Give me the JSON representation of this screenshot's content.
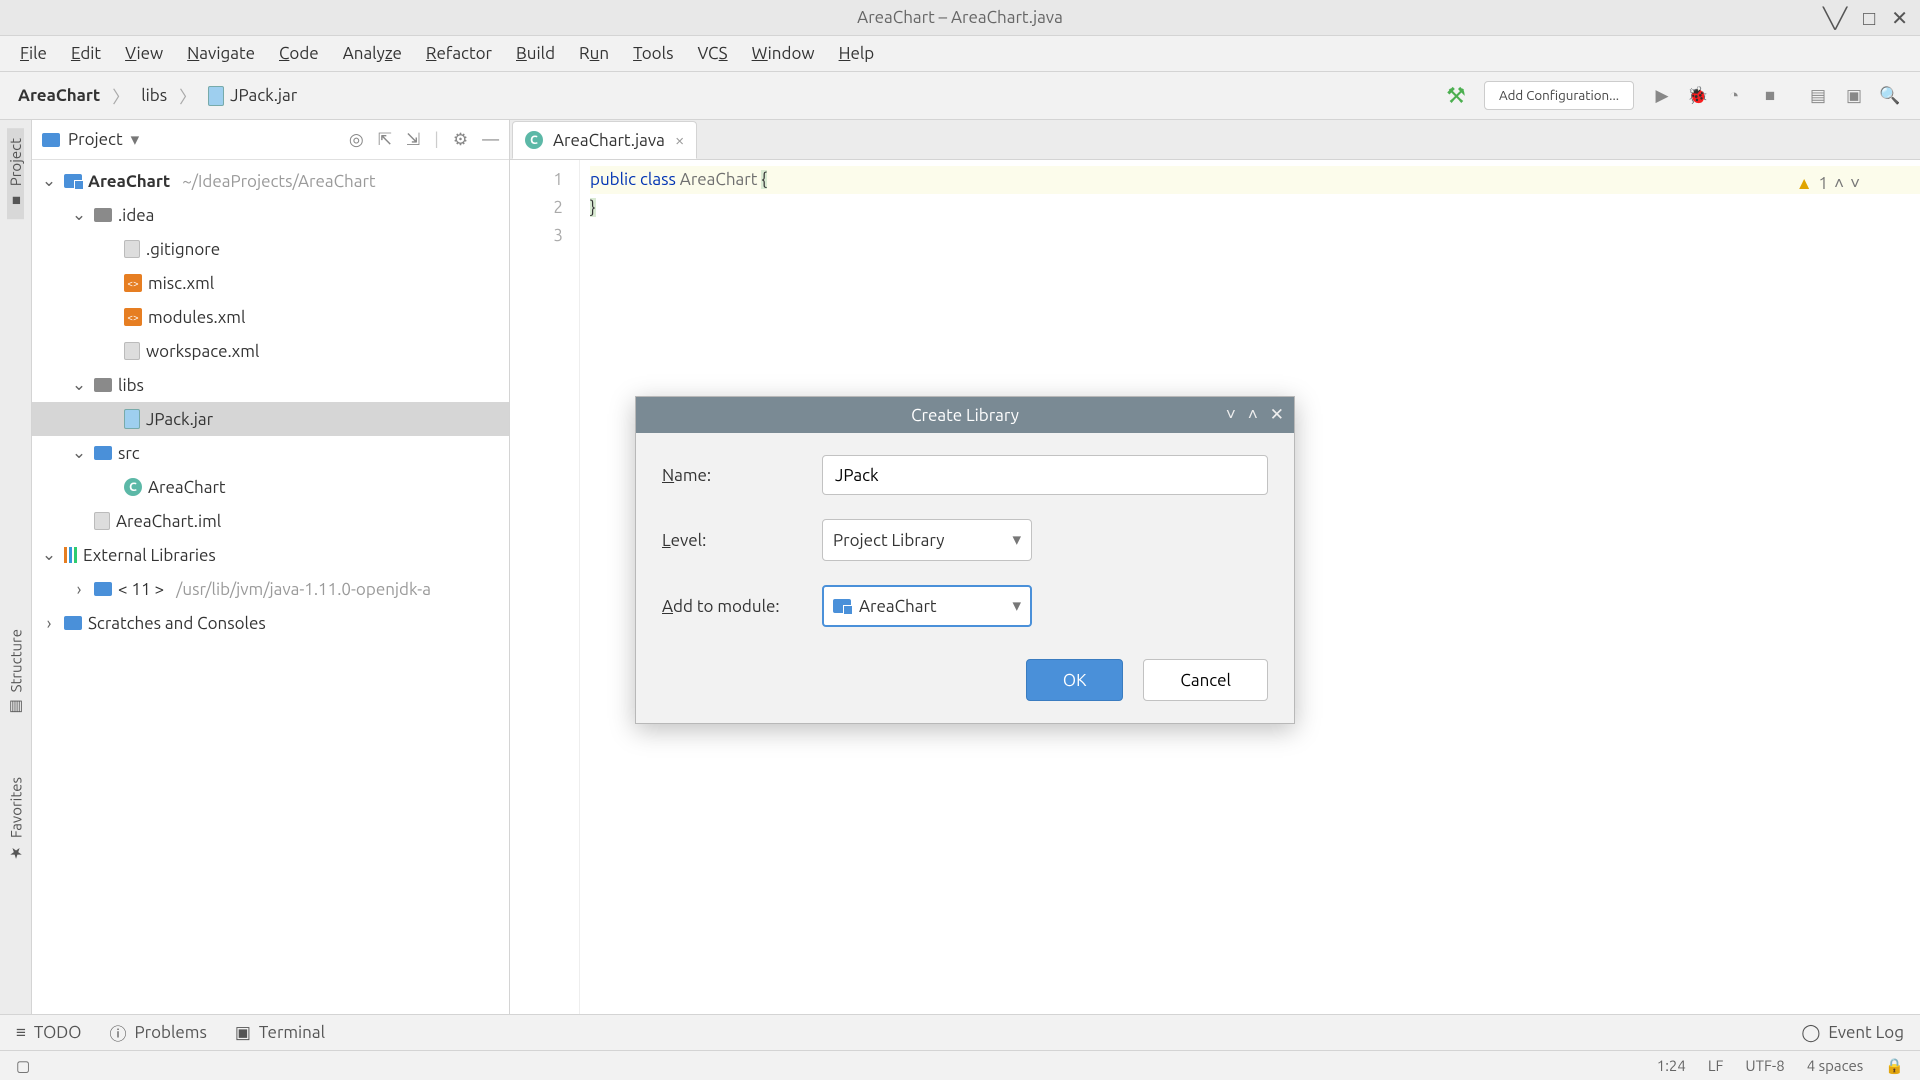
{
  "window": {
    "title": "AreaChart – AreaChart.java"
  },
  "menu": [
    "File",
    "Edit",
    "View",
    "Navigate",
    "Code",
    "Analyze",
    "Refactor",
    "Build",
    "Run",
    "Tools",
    "VCS",
    "Window",
    "Help"
  ],
  "breadcrumb": {
    "root": "AreaChart",
    "mid": "libs",
    "leaf": "JPack.jar"
  },
  "toolbar": {
    "addConfig": "Add Configuration..."
  },
  "sideTabs": {
    "project": "Project",
    "structure": "Structure",
    "favorites": "Favorites"
  },
  "projectPanel": {
    "title": "Project"
  },
  "tree": {
    "root": {
      "name": "AreaChart",
      "path": "~/IdeaProjects/AreaChart"
    },
    "idea": ".idea",
    "ideaFiles": [
      ".gitignore",
      "misc.xml",
      "modules.xml",
      "workspace.xml"
    ],
    "libs": "libs",
    "jar": "JPack.jar",
    "src": "src",
    "srcClass": "AreaChart",
    "iml": "AreaChart.iml",
    "extLib": "External Libraries",
    "jdk": {
      "label": "< 11 >",
      "path": "/usr/lib/jvm/java-1.11.0-openjdk-a"
    },
    "scratches": "Scratches and Consoles"
  },
  "editorTab": {
    "name": "AreaChart.java"
  },
  "code": {
    "kw_public": "public",
    "kw_class": "class",
    "clsname": "AreaChart",
    "open": "{",
    "close": "}",
    "lines": [
      "1",
      "2",
      "3"
    ],
    "warnCount": "1"
  },
  "dialog": {
    "title": "Create Library",
    "nameLabel": "Name:",
    "nameValue": "JPack",
    "levelLabel": "Level:",
    "levelValue": "Project Library",
    "moduleLabel": "Add to module:",
    "moduleValue": "AreaChart",
    "ok": "OK",
    "cancel": "Cancel"
  },
  "bottom": {
    "todo": "TODO",
    "problems": "Problems",
    "terminal": "Terminal",
    "eventlog": "Event Log"
  },
  "status": {
    "pos": "1:24",
    "sep": "LF",
    "enc": "UTF-8",
    "indent": "4 spaces"
  }
}
